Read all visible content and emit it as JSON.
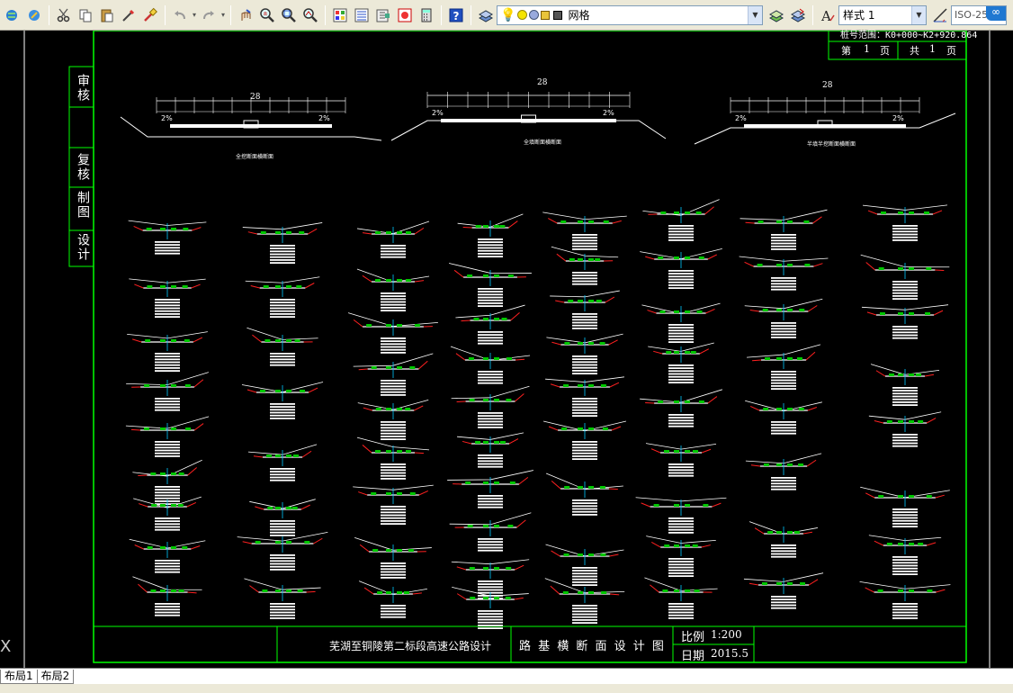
{
  "toolbar": {
    "layer_name": "网格",
    "text_style": "样式 1",
    "dim_style": "ISO-25",
    "badge_glyph": "∞"
  },
  "drawing": {
    "station_range": "桩号范围：K0+000~K2+920.864",
    "page_prefix": "第",
    "page_num": "1",
    "page_unit": "页",
    "total_prefix": "共",
    "total_num": "1",
    "total_unit": "页",
    "title_left": "芜湖至铜陵第二标段高速公路设计",
    "title_right": "路 基 横 断 面 设 计 图",
    "scale_label": "比例",
    "scale_value": "1:200",
    "date_label": "日期",
    "date_value": "2015.5",
    "sig_check": "审核",
    "sig_review": "复核",
    "sig_design": "设计",
    "sig_draft": "制图",
    "ucs_mark": "X",
    "top_sections": [
      {
        "width": "28",
        "caption": "全挖断面横断面"
      },
      {
        "width": "28",
        "caption": "全填断面横断面"
      },
      {
        "width": "28",
        "caption": "半填半挖断面横断面"
      }
    ]
  },
  "tabs": [
    "布局1",
    "布局2"
  ],
  "colors": {
    "frame": "#00ff00",
    "ground": "#ffffff",
    "slope": "#ff2020",
    "pavement": "#ffffff",
    "marker": "#00c800",
    "centerline": "#00c8ff"
  }
}
